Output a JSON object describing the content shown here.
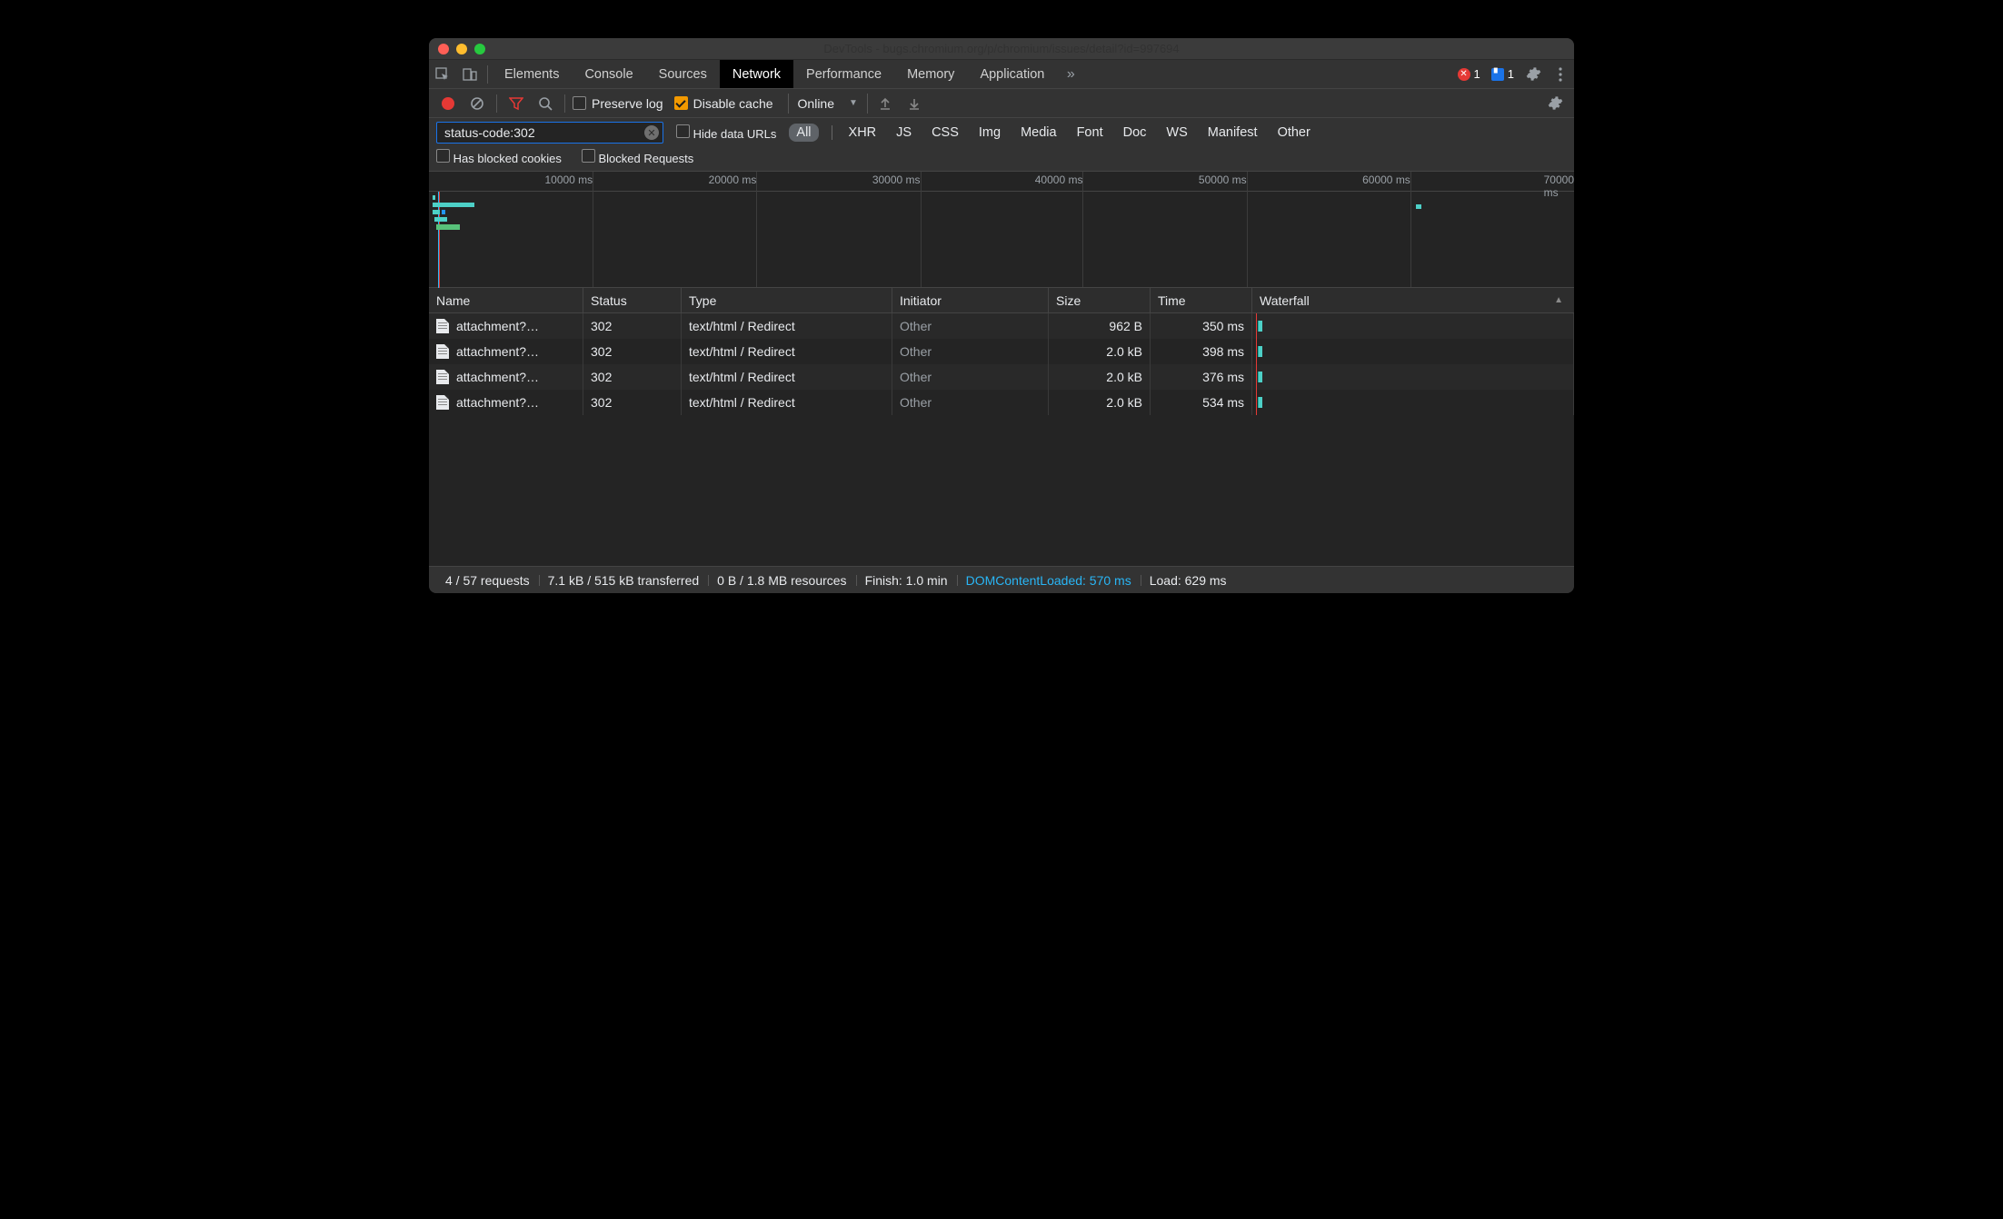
{
  "window": {
    "title": "DevTools - bugs.chromium.org/p/chromium/issues/detail?id=997694"
  },
  "main_tabs": {
    "items": [
      "Elements",
      "Console",
      "Sources",
      "Network",
      "Performance",
      "Memory",
      "Application"
    ],
    "active": "Network",
    "error_count": "1",
    "message_count": "1"
  },
  "toolbar": {
    "preserve_log_label": "Preserve log",
    "preserve_log_checked": false,
    "disable_cache_label": "Disable cache",
    "disable_cache_checked": true,
    "throttling": "Online"
  },
  "filter": {
    "value": "status-code:302",
    "hide_data_urls_label": "Hide data URLs",
    "types": [
      "All",
      "XHR",
      "JS",
      "CSS",
      "Img",
      "Media",
      "Font",
      "Doc",
      "WS",
      "Manifest",
      "Other"
    ],
    "active_type": "All",
    "has_blocked_cookies_label": "Has blocked cookies",
    "blocked_requests_label": "Blocked Requests"
  },
  "timeline": {
    "ticks": [
      "10000 ms",
      "20000 ms",
      "30000 ms",
      "40000 ms",
      "50000 ms",
      "60000 ms",
      "70000 ms"
    ]
  },
  "columns": {
    "name": "Name",
    "status": "Status",
    "type": "Type",
    "initiator": "Initiator",
    "size": "Size",
    "time": "Time",
    "waterfall": "Waterfall"
  },
  "requests": [
    {
      "name": "attachment?…",
      "status": "302",
      "type": "text/html / Redirect",
      "initiator": "Other",
      "size": "962 B",
      "time": "350 ms"
    },
    {
      "name": "attachment?…",
      "status": "302",
      "type": "text/html / Redirect",
      "initiator": "Other",
      "size": "2.0 kB",
      "time": "398 ms"
    },
    {
      "name": "attachment?…",
      "status": "302",
      "type": "text/html / Redirect",
      "initiator": "Other",
      "size": "2.0 kB",
      "time": "376 ms"
    },
    {
      "name": "attachment?…",
      "status": "302",
      "type": "text/html / Redirect",
      "initiator": "Other",
      "size": "2.0 kB",
      "time": "534 ms"
    }
  ],
  "status": {
    "requests": "4 / 57 requests",
    "transferred": "7.1 kB / 515 kB transferred",
    "resources": "0 B / 1.8 MB resources",
    "finish": "Finish: 1.0 min",
    "dcl": "DOMContentLoaded: 570 ms",
    "load": "Load: 629 ms"
  }
}
